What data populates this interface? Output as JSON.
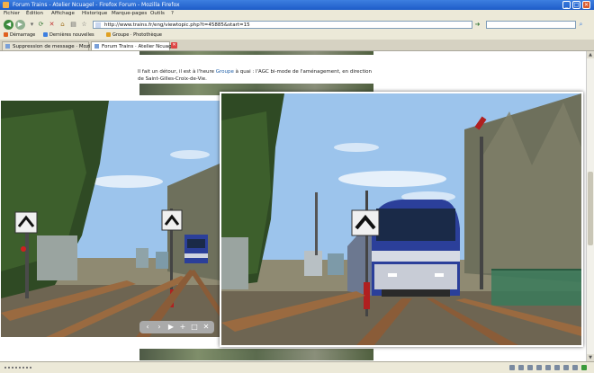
{
  "window": {
    "title": "Forum Trains - Atelier Ncuagel - Firefox Forum - Mozilla Firefox"
  },
  "menu": {
    "items": [
      "Fichier",
      "Édition",
      "Affichage",
      "Historique",
      "Marque-pages",
      "Outils",
      "?"
    ]
  },
  "nav": {
    "url": "http://www.trains.fr/eng/viewtopic.php?t=45885&start=15",
    "back_icon": "arrow-left-icon",
    "forward_icon": "arrow-right-icon"
  },
  "bookmarks": {
    "items": [
      {
        "label": "Démarrage",
        "color": "#e06020"
      },
      {
        "label": "Dernières nouvelles",
        "color": "#3d7fe0"
      },
      {
        "label": "Groupe · Photothèque",
        "color": "#e0a020"
      }
    ]
  },
  "tabs": [
    {
      "label": "Suppression de message · Mozilla Firefox",
      "active": false
    },
    {
      "label": "Forum Trains · Atelier Ncuagel",
      "active": true
    }
  ],
  "content": {
    "paragraph_prefix": "Il fait un détour, il est à l'heure",
    "paragraph_link": "Groupe",
    "paragraph_suffix": "à quai : l'AGC bi-mode de l'aménagement, en direction de Saint-Gilles-Croix-de-Vie."
  },
  "viewer": {
    "controls": [
      "‹",
      "›",
      "▶",
      "+",
      "□",
      "✕"
    ]
  },
  "colors": {
    "titlebar": "#1e5cc8",
    "chrome": "#ece9d8",
    "train_blue": "#2b3f9a",
    "sky": "#9cc4ec"
  }
}
